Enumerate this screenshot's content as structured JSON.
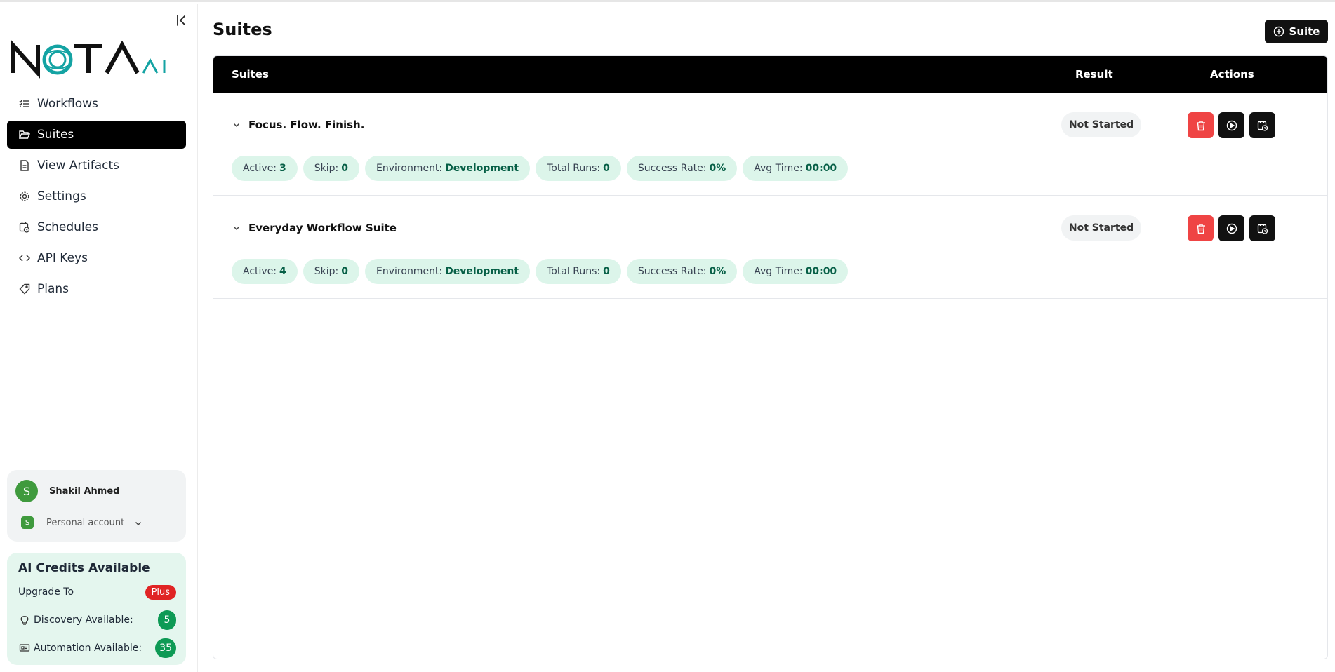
{
  "brand": {
    "logo_text": "NOTA",
    "logo_suffix": "AI",
    "accent": "#14a3a3"
  },
  "sidebar": {
    "items": [
      {
        "label": "Workflows",
        "icon": "list-check-icon",
        "active": false
      },
      {
        "label": "Suites",
        "icon": "folder-open-icon",
        "active": true
      },
      {
        "label": "View Artifacts",
        "icon": "file-icon",
        "active": false
      },
      {
        "label": "Settings",
        "icon": "gear-icon",
        "active": false
      },
      {
        "label": "Schedules",
        "icon": "calendar-clock-icon",
        "active": false
      },
      {
        "label": "API Keys",
        "icon": "code-icon",
        "active": false
      },
      {
        "label": "Plans",
        "icon": "tag-icon",
        "active": false
      }
    ],
    "user": {
      "avatar_letter": "S",
      "name": "Shakil Ahmed",
      "account_letter": "S",
      "account_label": "Personal account"
    },
    "credits": {
      "title": "AI Credits Available",
      "upgrade_label": "Upgrade To",
      "upgrade_badge": "Plus",
      "discovery_label": "Discovery Available:",
      "discovery_value": "5",
      "automation_label": "Automation Available:",
      "automation_value": "35"
    }
  },
  "main": {
    "title": "Suites",
    "add_button_label": "Suite",
    "table": {
      "headers": {
        "suites": "Suites",
        "result": "Result",
        "actions": "Actions"
      },
      "rows": [
        {
          "name": "Focus. Flow. Finish.",
          "result": "Not Started",
          "chips": [
            {
              "label": "Active:",
              "value": "3"
            },
            {
              "label": "Skip:",
              "value": "0"
            },
            {
              "label": "Environment:",
              "value": "Development"
            },
            {
              "label": "Total Runs:",
              "value": "0"
            },
            {
              "label": "Success Rate:",
              "value": "0%"
            },
            {
              "label": "Avg Time:",
              "value": "00:00"
            }
          ]
        },
        {
          "name": "Everyday Workflow Suite",
          "result": "Not Started",
          "chips": [
            {
              "label": "Active:",
              "value": "4"
            },
            {
              "label": "Skip:",
              "value": "0"
            },
            {
              "label": "Environment:",
              "value": "Development"
            },
            {
              "label": "Total Runs:",
              "value": "0"
            },
            {
              "label": "Success Rate:",
              "value": "0%"
            },
            {
              "label": "Avg Time:",
              "value": "00:00"
            }
          ]
        }
      ]
    }
  },
  "colors": {
    "delete": "#ef4444",
    "dark": "#111111",
    "chip_bg": "#dcf5ea",
    "chip_value": "#065f46",
    "badge_green": "#0e9a55",
    "badge_red": "#e02424"
  }
}
